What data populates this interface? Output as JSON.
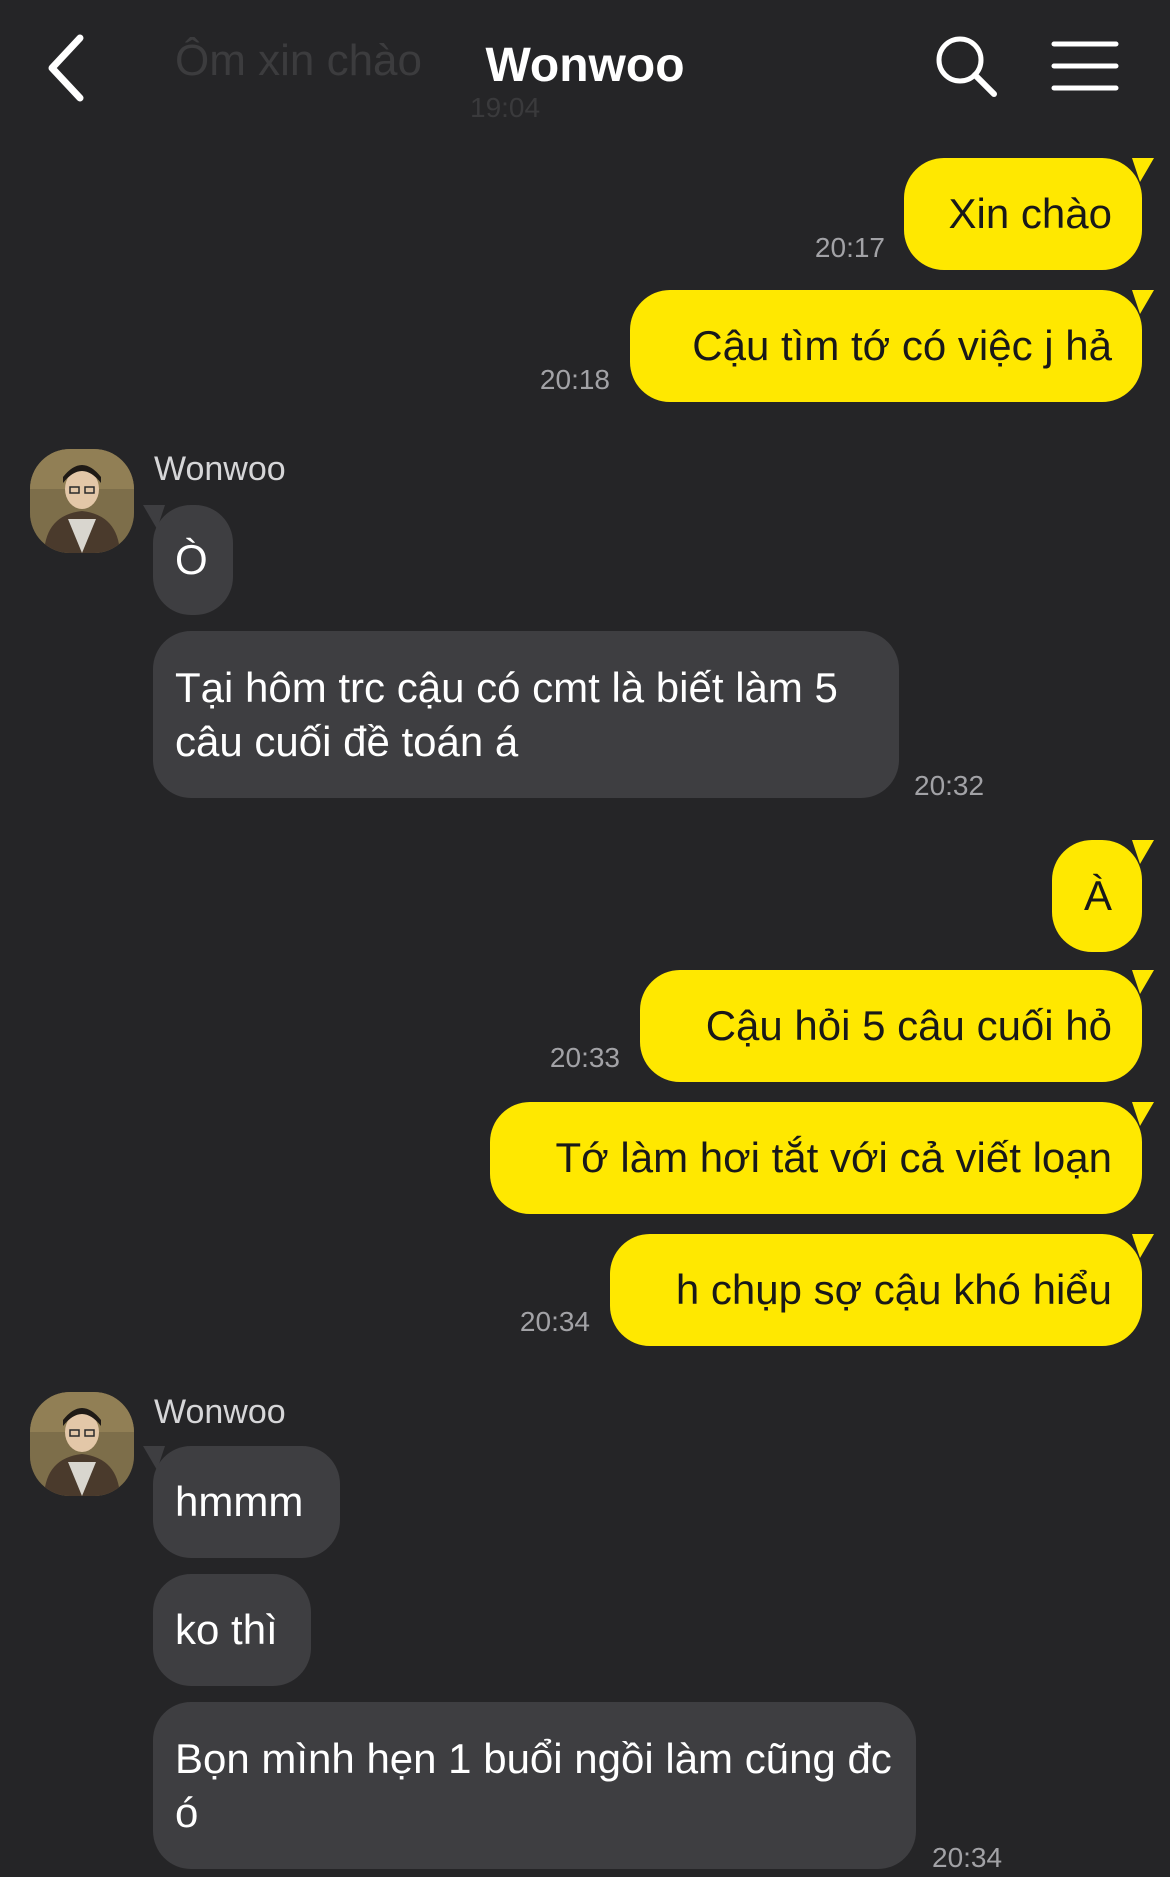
{
  "header": {
    "title": "Wonwoo",
    "ghost_text": "Ôm xin chào",
    "ghost_time": "19:04",
    "back_icon": "chevron-left-icon",
    "search_icon": "search-icon",
    "menu_icon": "menu-icon"
  },
  "colors": {
    "background": "#252527",
    "outgoing_bubble": "#ffe800",
    "incoming_bubble": "#3e3e41",
    "timestamp": "#a2a2a6"
  },
  "messages": {
    "m1": {
      "text": "Xin chào",
      "time": "20:17"
    },
    "m2": {
      "text": "Cậu tìm tớ có việc j hả",
      "time": "20:18"
    },
    "g1": {
      "sender": "Wonwoo"
    },
    "m3": {
      "text": "Ò"
    },
    "m4": {
      "text": "Tại hôm trc cậu có cmt là biết làm 5 câu cuối đề toán á",
      "time": "20:32"
    },
    "m5": {
      "text": "À"
    },
    "m6": {
      "text": "Cậu hỏi 5 câu cuối hỏ",
      "time": "20:33"
    },
    "m7": {
      "text": "Tớ làm hơi tắt với cả viết loạn"
    },
    "m8": {
      "text": "h chụp sợ cậu khó hiểu",
      "time": "20:34"
    },
    "g2": {
      "sender": "Wonwoo"
    },
    "m9": {
      "text": "hmmm"
    },
    "m10": {
      "text": "ko thì"
    },
    "m11": {
      "text": "Bọn mình hẹn 1 buổi ngồi làm cũng đc ó",
      "time": "20:34"
    }
  }
}
